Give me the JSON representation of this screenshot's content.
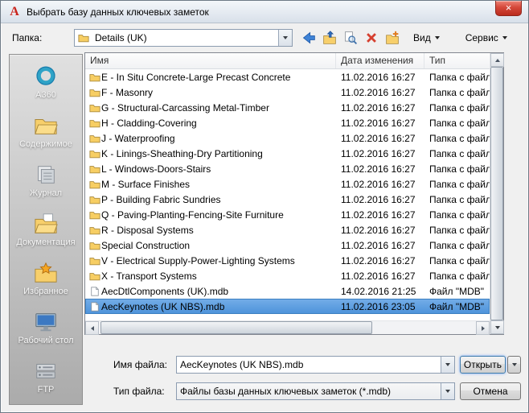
{
  "window": {
    "title": "Выбрать базу данных ключевых заметок"
  },
  "icons": {
    "close": "×",
    "app_logo": "A"
  },
  "colors": {
    "selection": "#4f9be3",
    "folder": "#f7cf6b",
    "titlebar": "#d8e0ea",
    "delete_icon": "#d6402f",
    "back_icon": "#3f83d6"
  },
  "toolbar": {
    "folder_label": "Папка:",
    "folder_value": "Details (UK)",
    "view_label": "Вид",
    "tools_label": "Сервис"
  },
  "sidebar": {
    "items": [
      {
        "label": "A360"
      },
      {
        "label": "Содержимое"
      },
      {
        "label": "Журнал"
      },
      {
        "label": "Документация"
      },
      {
        "label": "Избранное"
      },
      {
        "label": "Рабочий стол"
      },
      {
        "label": "FTP"
      }
    ]
  },
  "list": {
    "columns": [
      "Имя",
      "Дата изменения",
      "Тип"
    ],
    "rows": [
      {
        "name": "E - In Situ Concrete-Large Precast Concrete",
        "date": "11.02.2016 16:27",
        "type": "Папка с файлами"
      },
      {
        "name": "F - Masonry",
        "date": "11.02.2016 16:27",
        "type": "Папка с файлами"
      },
      {
        "name": "G - Structural-Carcassing Metal-Timber",
        "date": "11.02.2016 16:27",
        "type": "Папка с файлами"
      },
      {
        "name": "H - Cladding-Covering",
        "date": "11.02.2016 16:27",
        "type": "Папка с файлами"
      },
      {
        "name": "J - Waterproofing",
        "date": "11.02.2016 16:27",
        "type": "Папка с файлами"
      },
      {
        "name": "K - Linings-Sheathing-Dry Partitioning",
        "date": "11.02.2016 16:27",
        "type": "Папка с файлами"
      },
      {
        "name": "L - Windows-Doors-Stairs",
        "date": "11.02.2016 16:27",
        "type": "Папка с файлами"
      },
      {
        "name": "M - Surface Finishes",
        "date": "11.02.2016 16:27",
        "type": "Папка с файлами"
      },
      {
        "name": "P - Building Fabric Sundries",
        "date": "11.02.2016 16:27",
        "type": "Папка с файлами"
      },
      {
        "name": "Q - Paving-Planting-Fencing-Site Furniture",
        "date": "11.02.2016 16:27",
        "type": "Папка с файлами"
      },
      {
        "name": "R - Disposal Systems",
        "date": "11.02.2016 16:27",
        "type": "Папка с файлами"
      },
      {
        "name": "Special Construction",
        "date": "11.02.2016 16:27",
        "type": "Папка с файлами"
      },
      {
        "name": "V - Electrical Supply-Power-Lighting Systems",
        "date": "11.02.2016 16:27",
        "type": "Папка с файлами"
      },
      {
        "name": "X - Transport Systems",
        "date": "11.02.2016 16:27",
        "type": "Папка с файлами"
      },
      {
        "name": "AecDtlComponents (UK).mdb",
        "date": "14.02.2016 21:25",
        "type": "Файл \"MDB\""
      },
      {
        "name": "AecKeynotes (UK NBS).mdb",
        "date": "11.02.2016 23:05",
        "type": "Файл \"MDB\"",
        "selected": true
      }
    ]
  },
  "footer": {
    "filename_label": "Имя файла:",
    "filename_value": "AecKeynotes (UK NBS).mdb",
    "filetype_label": "Тип файла:",
    "filetype_value": "Файлы базы данных ключевых заметок (*.mdb)",
    "open_label": "Открыть",
    "cancel_label": "Отмена"
  }
}
